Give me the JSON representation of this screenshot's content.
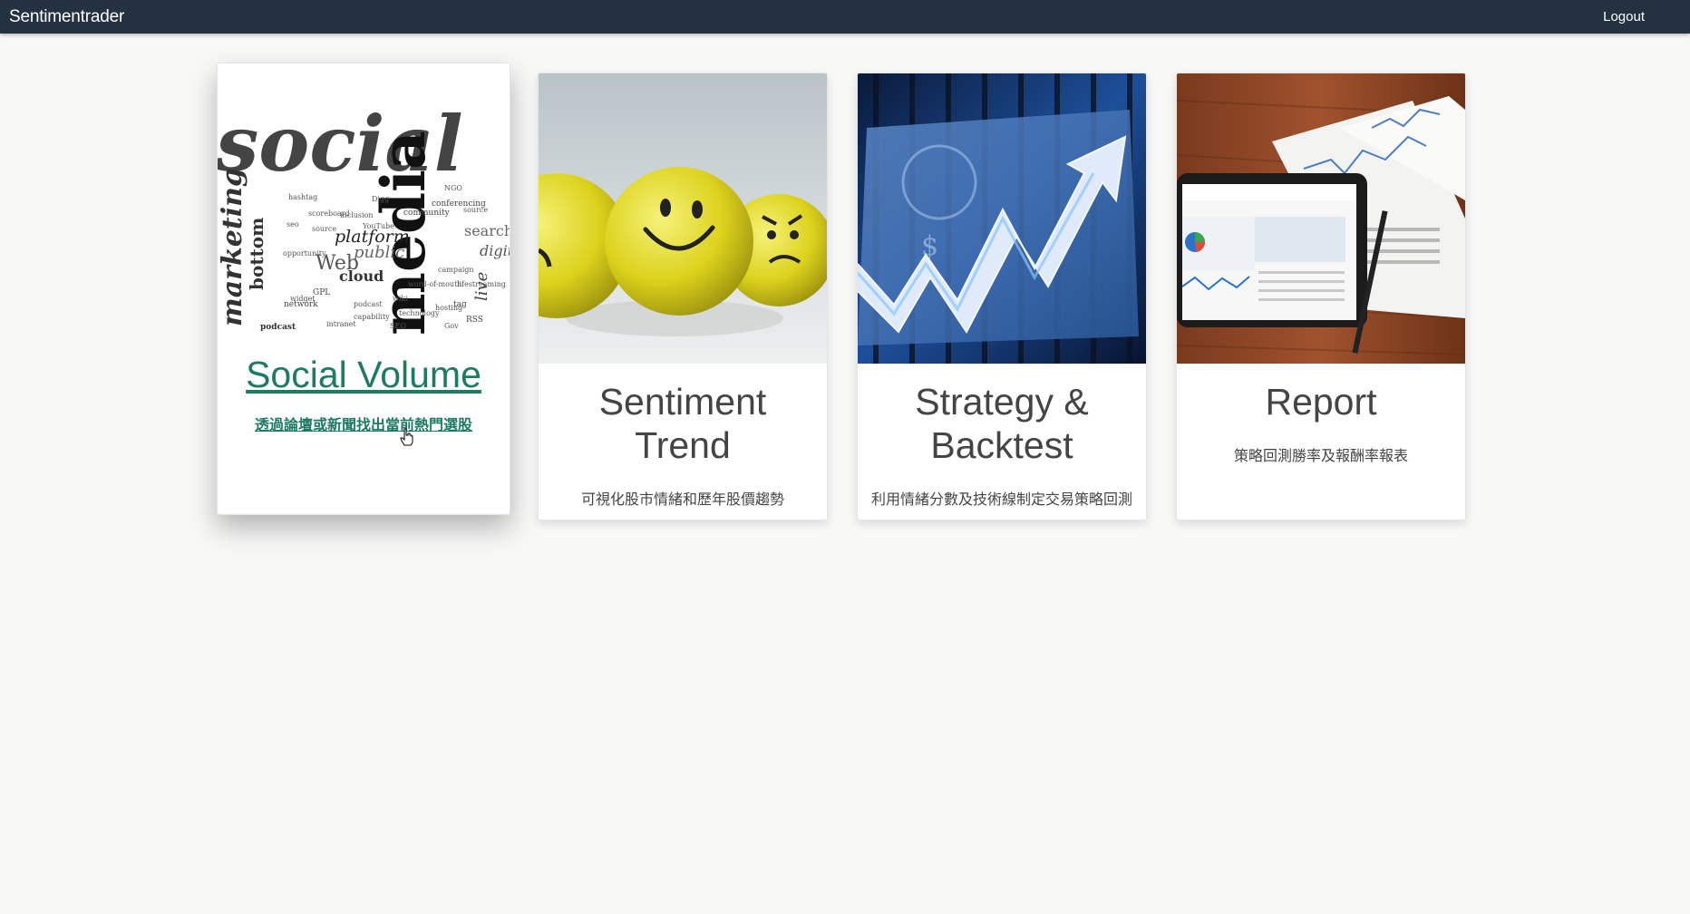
{
  "navbar": {
    "brand": "Sentimentrader",
    "logout": "Logout"
  },
  "cards": [
    {
      "title": "Social Volume",
      "subtitle": "透過論壇或新聞找出當前熱門選股",
      "image_icon": "social-media-word-cloud"
    },
    {
      "title": "Sentiment Trend",
      "subtitle": "可視化股市情緒和歷年股價趨勢",
      "image_icon": "emoji-balls"
    },
    {
      "title": "Strategy & Backtest",
      "subtitle": "利用情緒分數及技術線制定交易策略回測",
      "image_icon": "dollar-up-arrow"
    },
    {
      "title": "Report",
      "subtitle": "策略回測勝率及報酬率報表",
      "image_icon": "tablet-report"
    }
  ],
  "word_cloud": {
    "main": "social",
    "secondary": "media",
    "vertical": "marketing",
    "words": [
      "platform",
      "Web",
      "public",
      "cloud",
      "search",
      "digital",
      "bottom",
      "RSS",
      "podcast",
      "GPL",
      "community",
      "conferencing",
      "network",
      "tag",
      "live"
    ]
  },
  "colors": {
    "navbar_bg": "#243140",
    "accent": "#1d7a63",
    "page_bg": "#f8f8f7"
  }
}
